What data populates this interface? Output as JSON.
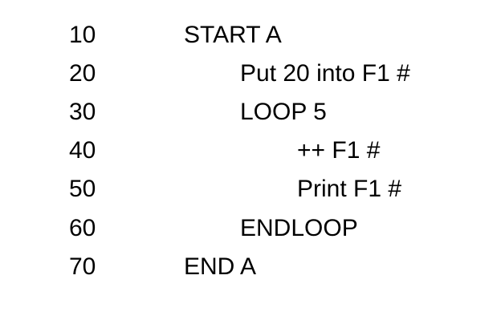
{
  "program": {
    "lines": [
      {
        "number": "10",
        "code": "START A"
      },
      {
        "number": "20",
        "code": "Put 20 into F1 #"
      },
      {
        "number": "30",
        "code": "LOOP 5"
      },
      {
        "number": "40",
        "code": "++ F1 #"
      },
      {
        "number": "50",
        "code": "Print F1 #"
      },
      {
        "number": "60",
        "code": "ENDLOOP"
      },
      {
        "number": "70",
        "code": "END A"
      }
    ]
  }
}
